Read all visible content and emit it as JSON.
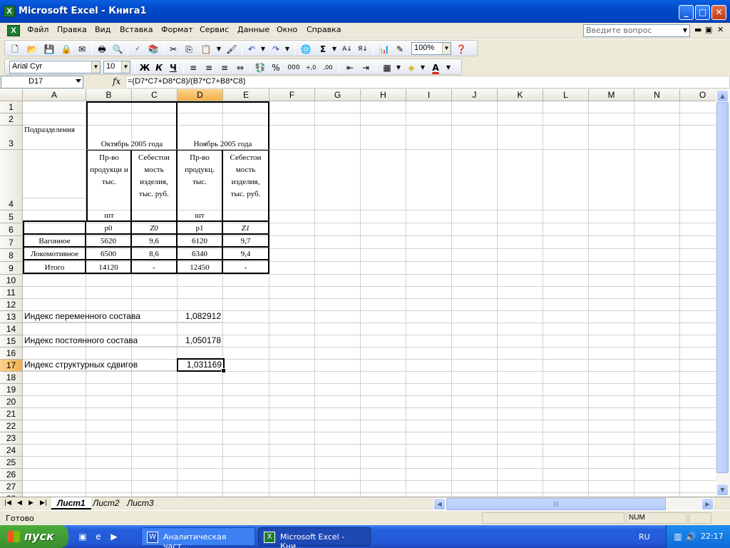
{
  "window": {
    "title": "Microsoft Excel - Книга1",
    "app_icon": "X",
    "controls": {
      "minimize": "_",
      "maximize": "□",
      "close": "✕"
    }
  },
  "menu": {
    "items": [
      "Файл",
      "Правка",
      "Вид",
      "Вставка",
      "Формат",
      "Сервис",
      "Данные",
      "Окно",
      "Справка"
    ],
    "help_placeholder": "Введите вопрос",
    "doc_controls": [
      "×",
      "▭",
      "×"
    ]
  },
  "toolbar": {
    "zoom": "100%",
    "sigma": "Σ",
    "font_name": "Arial Cyr",
    "font_size": "10",
    "bold": "Ж",
    "italic": "К",
    "underline": "Ч",
    "percent": "%",
    "thousands": "000",
    "inc_decimal": "+,0",
    "dec_decimal": ",00",
    "font_color_letter": "A"
  },
  "formula_bar": {
    "cell_ref": "D17",
    "fx": "fx",
    "formula": "=(D7*C7+D8*C8)/(B7*C7+B8*C8)"
  },
  "grid": {
    "columns": [
      "A",
      "B",
      "C",
      "D",
      "E",
      "F",
      "G",
      "H",
      "I",
      "J",
      "K",
      "L",
      "M",
      "N",
      "O"
    ],
    "selected_column": "D",
    "selected_row": "17",
    "rows": [
      "1",
      "2",
      "3",
      "4",
      "5",
      "6",
      "7",
      "8",
      "9",
      "10",
      "11",
      "12",
      "13",
      "14",
      "15",
      "16",
      "17",
      "18",
      "19",
      "20",
      "21",
      "22",
      "23",
      "24",
      "25",
      "26",
      "27",
      "28"
    ],
    "header_left": "Подразделения",
    "october": "Октябрь 2005 года",
    "november": "Ноябрь 2005 года",
    "b4": "Пр-во продукци и тыс.",
    "c4": "Себестои мость изделия, тыс. руб.",
    "d4": "Пр-во продукц. тыс.",
    "e4": "Себестои мость изделия, тыс. руб.",
    "b5": "шт",
    "d5": "шт",
    "b6": "p0",
    "c6": "Z0",
    "d6": "p1",
    "e6": "Z1",
    "a7": "Вагонное",
    "b7": "5620",
    "c7": "9,6",
    "d7": "6120",
    "e7": "9,7",
    "a8": "Локомотивное",
    "b8": "6500",
    "c8": "8,6",
    "d8": "6340",
    "e8": "9,4",
    "a9": "Итого",
    "b9": "14120",
    "c9": "-",
    "d9": "12450",
    "e9": "-",
    "a13": "Индекс переменного состава",
    "d13": "1,082912",
    "a15": "Индекс постоянного состава",
    "d15": "1,050178",
    "a17": "Индекс структурных сдвигов",
    "d17": "1,031169"
  },
  "sheets": {
    "tabs": [
      "Лист1",
      "Лист2",
      "Лист3"
    ],
    "active": "Лист1"
  },
  "status": {
    "ready": "Готово",
    "num": "NUM"
  },
  "taskbar": {
    "start": "пуск",
    "tasks": [
      "Аналитическая част...",
      "Microsoft Excel - Кни..."
    ],
    "language": "RU",
    "clock": "22:17"
  }
}
